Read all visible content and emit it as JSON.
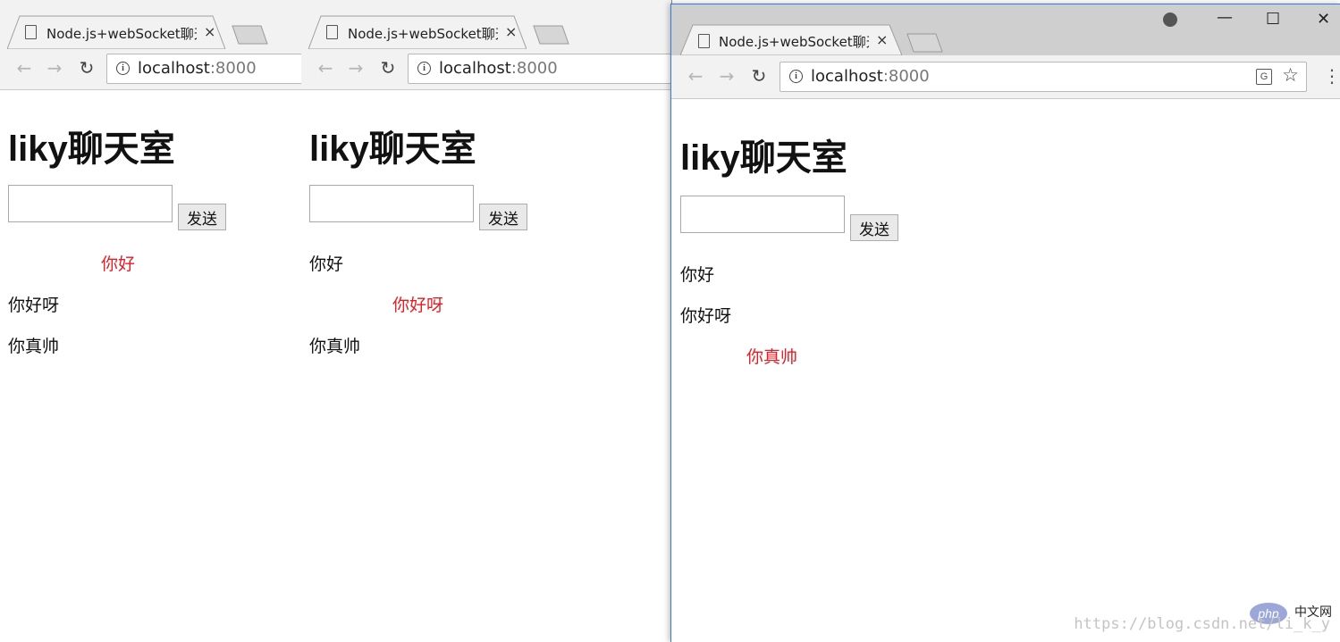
{
  "tab": {
    "title": "Node.js+webSocket聊天室",
    "close": "×"
  },
  "address": {
    "host": "localhost",
    "port": ":8000"
  },
  "page": {
    "heading": "liky聊天室",
    "send_label": "发送"
  },
  "windows": [
    {
      "messages": [
        {
          "text": "你好",
          "self": true
        },
        {
          "text": "你好呀",
          "self": false
        },
        {
          "text": "你真帅",
          "self": false
        }
      ]
    },
    {
      "messages": [
        {
          "text": "你好",
          "self": false
        },
        {
          "text": "你好呀",
          "self": true
        },
        {
          "text": "你真帅",
          "self": false
        }
      ]
    },
    {
      "messages": [
        {
          "text": "你好",
          "self": false
        },
        {
          "text": "你好呀",
          "self": false
        },
        {
          "text": "你真帅",
          "self": true
        }
      ]
    }
  ],
  "colors": {
    "self_message": "#e51c23",
    "other_message": "#111111",
    "active_frame": "#3a7bd5"
  },
  "icons": {
    "back": "arrow-left-icon",
    "forward": "arrow-right-icon",
    "reload": "reload-icon",
    "info": "info-icon",
    "translate": "translate-icon",
    "bookmark": "star-icon",
    "menu": "kebab-menu-icon",
    "profile": "profile-icon"
  },
  "window_controls": {
    "minimize": "—",
    "maximize": "☐",
    "close": "✕"
  },
  "watermark": {
    "site": "php",
    "site_label": "中文网",
    "url": "https://blog.csdn.net/li_k_y"
  }
}
